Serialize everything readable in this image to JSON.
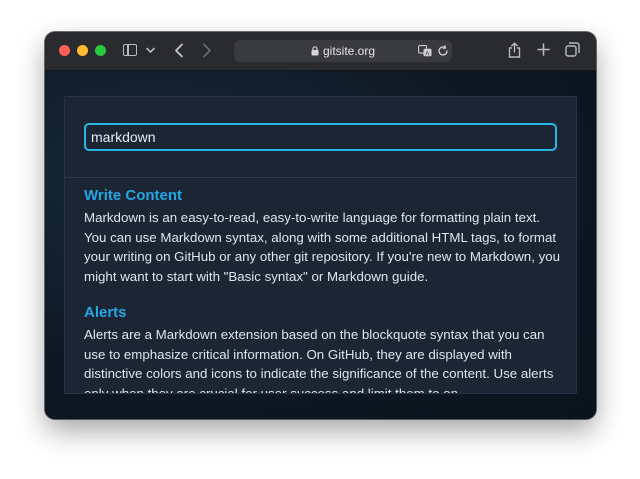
{
  "browser": {
    "url": "gitsite.org",
    "icons": {
      "sidebar": "sidebar-icon",
      "chevron": "chevron-down-icon",
      "back": "back-arrow-icon",
      "forward": "forward-arrow-icon",
      "lock": "lock-icon",
      "translate": "translate-icon",
      "reload": "reload-icon",
      "share": "share-icon",
      "new_tab": "plus-icon",
      "tabs": "tabs-overview-icon"
    }
  },
  "search": {
    "value": "markdown"
  },
  "results": [
    {
      "title": "Write Content",
      "body": "Markdown is an easy-to-read, easy-to-write language for formatting plain text. You can use Markdown syntax, along with some additional HTML tags, to format your writing on GitHub or any other git repository. If you're new to Markdown, you might want to start with \"Basic syntax\" or Markdown guide."
    },
    {
      "title": "Alerts",
      "body": "Alerts are a Markdown extension based on the blockquote syntax that you can use to emphasize critical information. On GitHub, they are displayed with distinctive colors and icons to indicate the significance of the content. Use alerts only when they are crucial for user success and limit them to on"
    }
  ],
  "colors": {
    "accent": "#29b6e6",
    "title": "#22a7e4",
    "panel": "#1b2534"
  }
}
